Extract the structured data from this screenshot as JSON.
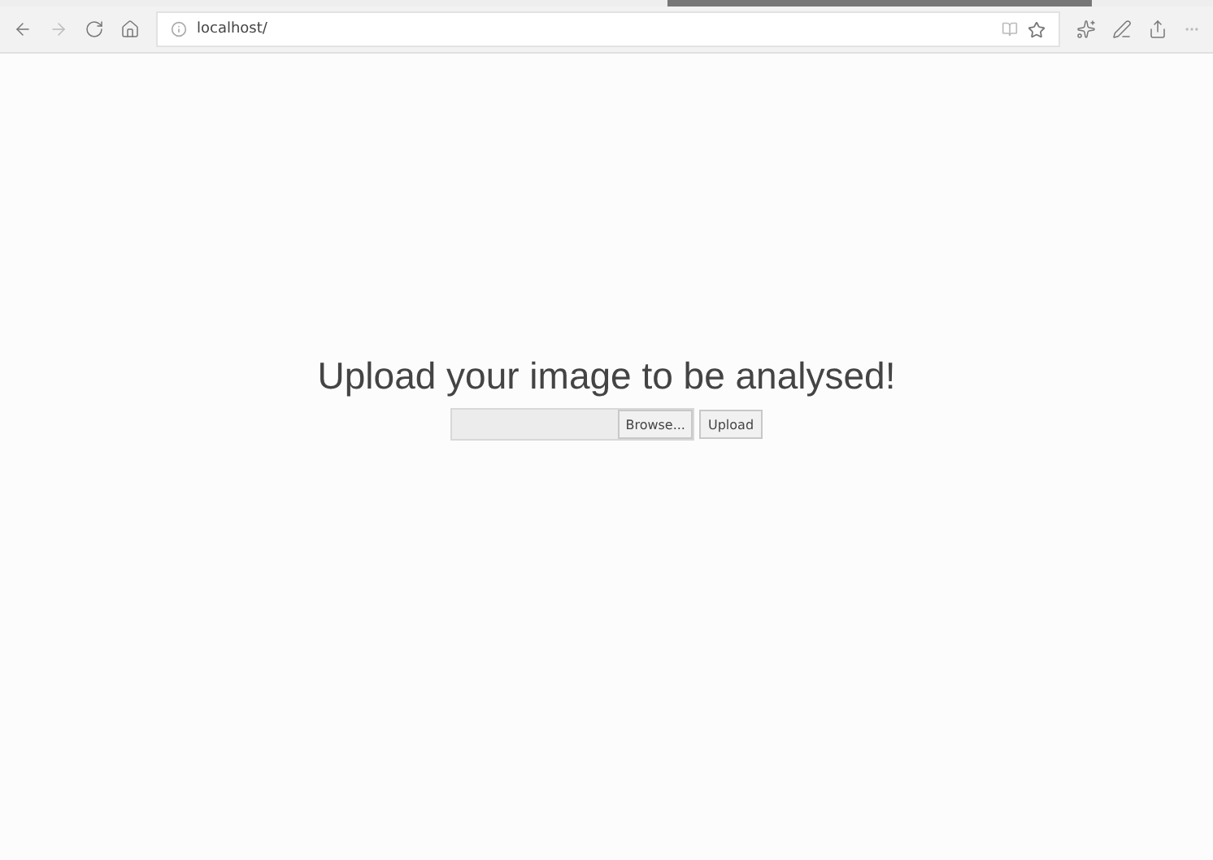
{
  "browser": {
    "address": "localhost/"
  },
  "page": {
    "heading": "Upload your image to be analysed!",
    "file_input": {
      "browse_label": "Browse..."
    },
    "submit_label": "Upload"
  }
}
